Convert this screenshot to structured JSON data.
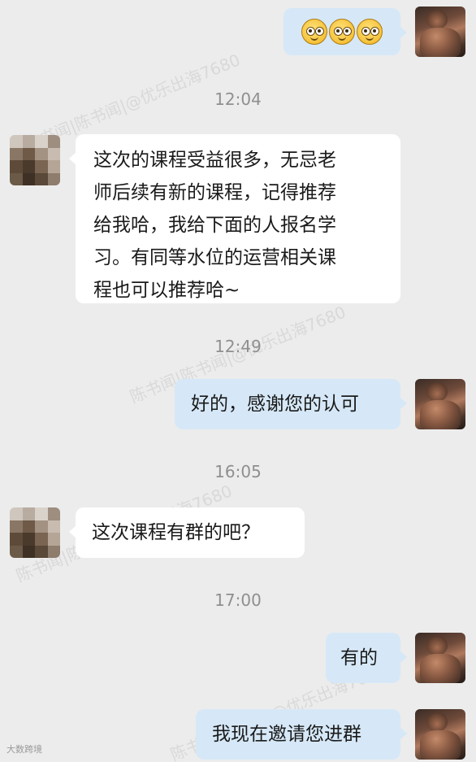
{
  "chat": {
    "messages": [
      {
        "sender": "self",
        "type": "emoji",
        "emoji_icon": "wide-eyed-face-icon",
        "count": 3
      },
      {
        "type": "time",
        "text": "12:04"
      },
      {
        "sender": "other",
        "type": "text",
        "lines": [
          "这次的课程受益很多，无忌老",
          "师后续有新的课程，记得推荐",
          "给我哈，我给下面的人报名学",
          "习。有同等水位的运营相关课",
          "程也可以推荐哈~"
        ]
      },
      {
        "type": "time",
        "text": "12:49"
      },
      {
        "sender": "self",
        "type": "text",
        "text": "好的，感谢您的认可"
      },
      {
        "type": "time",
        "text": "16:05"
      },
      {
        "sender": "other",
        "type": "text",
        "text": "这次课程有群的吧？"
      },
      {
        "type": "time",
        "text": "17:00"
      },
      {
        "sender": "self",
        "type": "text",
        "text": "有的"
      },
      {
        "sender": "self",
        "type": "text",
        "text": "我现在邀请您进群"
      }
    ]
  },
  "watermarks": [
    "陈书闻|陈书闻|@优乐出海7680",
    "陈书闻|陈书闻|@优乐出海7680",
    "陈书闻|陈书闻|@优乐出海7680",
    "陈书闻|陈书闻|@优乐出海7680"
  ],
  "corner_mark": "大数跨境",
  "colors": {
    "background": "#ececec",
    "bubble_self": "#d6e8f7",
    "bubble_other": "#ffffff",
    "timestamp": "#8f8f8f"
  }
}
